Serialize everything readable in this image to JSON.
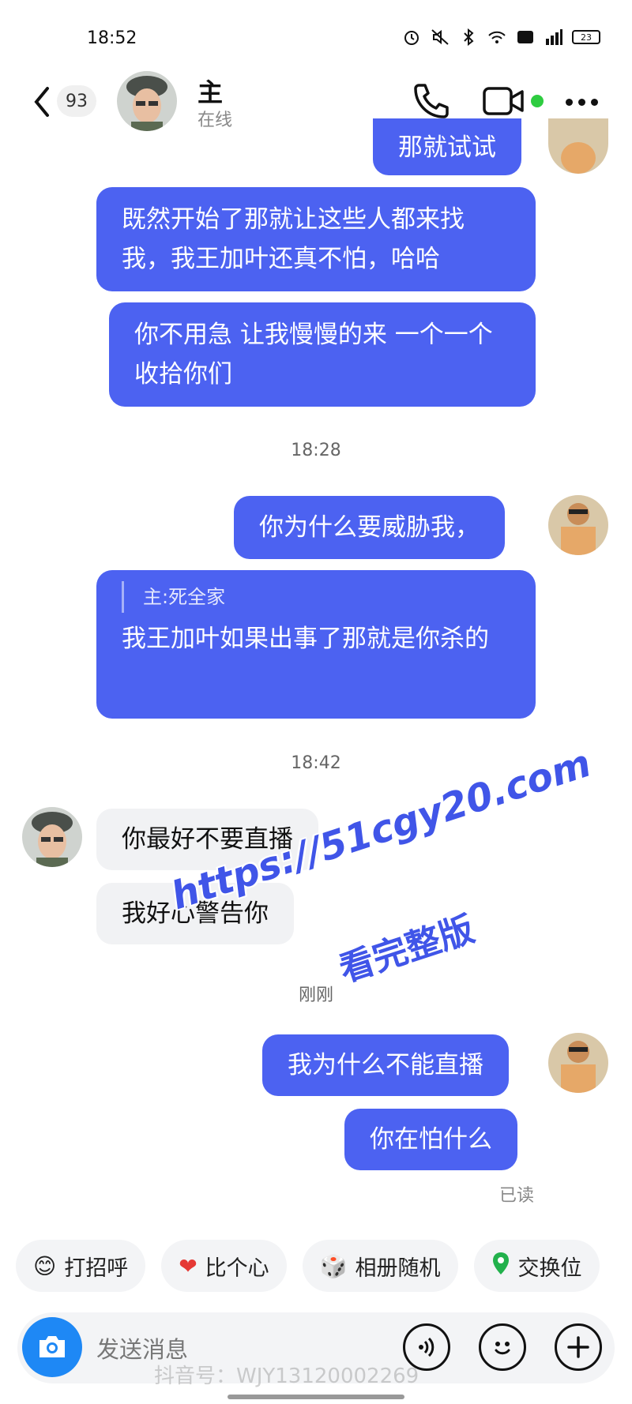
{
  "status_bar": {
    "time": "18:52",
    "battery": "23"
  },
  "header": {
    "unread_count": "93",
    "contact_name": "主",
    "contact_status": "在线"
  },
  "messages": [
    {
      "dir": "out",
      "text": "那就试试"
    },
    {
      "dir": "out",
      "text": "既然开始了那就让这些人都来找我，我王加叶还真不怕，哈哈"
    },
    {
      "dir": "out",
      "text": "你不用急 让我慢慢的来 一个一个收拾你们"
    },
    {
      "time": "18:28"
    },
    {
      "dir": "out",
      "text": "你为什么要威胁我，"
    },
    {
      "dir": "out",
      "quote": "主:死全家",
      "text": "我王加叶如果出事了那就是你杀的"
    },
    {
      "time": "18:42"
    },
    {
      "dir": "in",
      "text": "你最好不要直播"
    },
    {
      "dir": "in",
      "text": "我好心警告你"
    },
    {
      "time": "刚刚"
    },
    {
      "dir": "out",
      "text": "我为什么不能直播"
    },
    {
      "dir": "out",
      "text": "你在怕什么"
    }
  ],
  "read_receipt": "已读",
  "watermark": {
    "line1": "https://51cgy20.com",
    "line2": "看完整版",
    "bottom": "抖音号：WJY13120002269"
  },
  "quick_replies": [
    {
      "icon": "wave-emoji-icon",
      "label": "打招呼"
    },
    {
      "icon": "heart-icon",
      "label": "比个心"
    },
    {
      "icon": "dice-icon",
      "label": "相册随机"
    },
    {
      "icon": "location-pin-icon",
      "label": "交换位"
    }
  ],
  "input": {
    "placeholder": "发送消息"
  },
  "colors": {
    "outgoing_bubble": "#4c62f1",
    "incoming_bubble": "#f1f2f4",
    "online": "#2ecc40",
    "camera": "#1e88f5"
  }
}
